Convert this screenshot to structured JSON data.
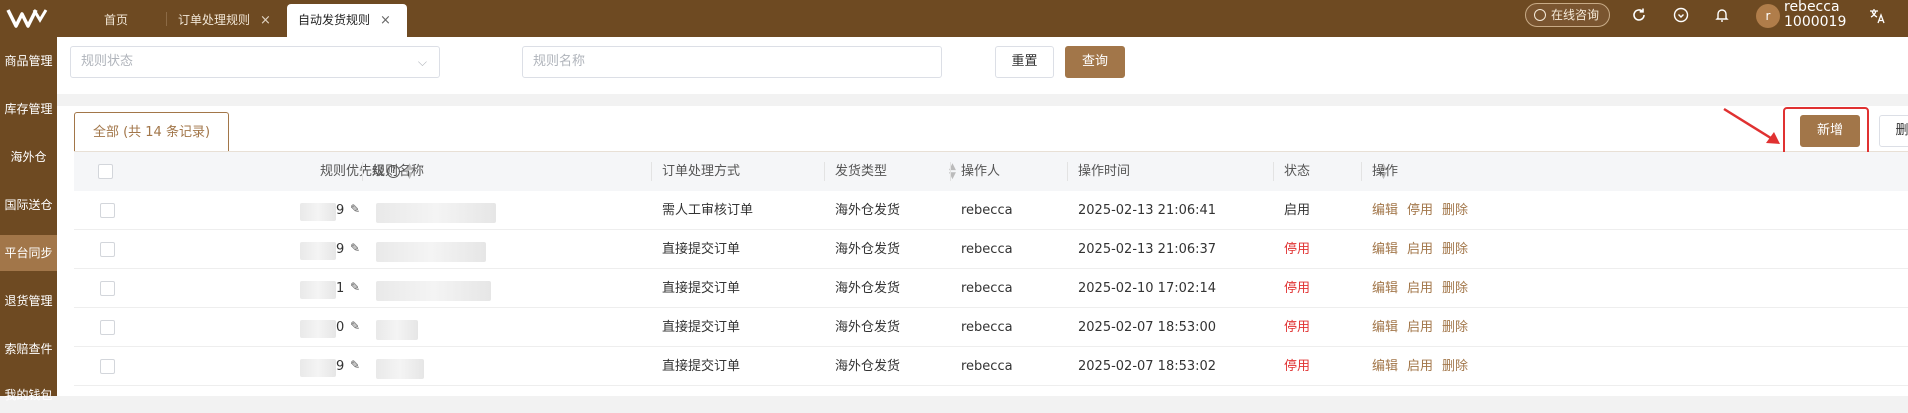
{
  "topbar": {
    "tabs": [
      {
        "label": "首页"
      },
      {
        "label": "订单处理规则",
        "close": "×"
      },
      {
        "label": "自动发货规则",
        "close": "×",
        "active": true
      }
    ],
    "consult_label": "在线咨询",
    "user_initial": "r",
    "user_name": "rebecca",
    "user_id": "1000019",
    "icons": [
      "refresh-icon",
      "heart-icon",
      "bell-icon",
      "translate-icon"
    ]
  },
  "sidebar": {
    "items": [
      {
        "label": "商品管理"
      },
      {
        "label": "库存管理"
      },
      {
        "label": "海外仓"
      },
      {
        "label": "国际送仓"
      },
      {
        "label": "平台同步",
        "active": true
      },
      {
        "label": "退货管理"
      },
      {
        "label": "索赔查件"
      },
      {
        "label": "我的钱包"
      }
    ]
  },
  "filters": {
    "status_placeholder": "规则状态",
    "name_placeholder": "规则名称",
    "reset_label": "重置",
    "query_label": "查询"
  },
  "toolbar": {
    "record_tab_label": "全部 (共 14 条记录)",
    "new_label": "新增",
    "delete_label": "删除"
  },
  "table": {
    "columns": {
      "priority": "规则优先级",
      "name": "规则名称",
      "method": "订单处理方式",
      "type": "发货类型",
      "operator": "操作人",
      "time": "操作时间",
      "status": "状态",
      "actions": "操作"
    },
    "rows": [
      {
        "priority_suffix": "9",
        "method": "需人工审核订单",
        "type": "海外仓发货",
        "operator": "rebecca",
        "time": "2025-02-13 21:06:41",
        "status": "启用",
        "enabled": true,
        "edit": "编辑",
        "toggle": "停用",
        "delete": "删除"
      },
      {
        "priority_suffix": "9",
        "method": "直接提交订单",
        "type": "海外仓发货",
        "operator": "rebecca",
        "time": "2025-02-13 21:06:37",
        "status": "停用",
        "enabled": false,
        "edit": "编辑",
        "toggle": "启用",
        "delete": "删除"
      },
      {
        "priority_suffix": "1",
        "method": "直接提交订单",
        "type": "海外仓发货",
        "operator": "rebecca",
        "time": "2025-02-10 17:02:14",
        "status": "停用",
        "enabled": false,
        "edit": "编辑",
        "toggle": "启用",
        "delete": "删除"
      },
      {
        "priority_suffix": "0",
        "method": "直接提交订单",
        "type": "海外仓发货",
        "operator": "rebecca",
        "time": "2025-02-07 18:53:00",
        "status": "停用",
        "enabled": false,
        "edit": "编辑",
        "toggle": "启用",
        "delete": "删除"
      },
      {
        "priority_suffix": "9",
        "method": "直接提交订单",
        "type": "海外仓发货",
        "operator": "rebecca",
        "time": "2025-02-07 18:53:02",
        "status": "停用",
        "enabled": false,
        "edit": "编辑",
        "toggle": "启用",
        "delete": "删除"
      }
    ]
  },
  "colors": {
    "brand": "#6e4a22",
    "accent": "#a27649",
    "danger": "#e03131"
  }
}
